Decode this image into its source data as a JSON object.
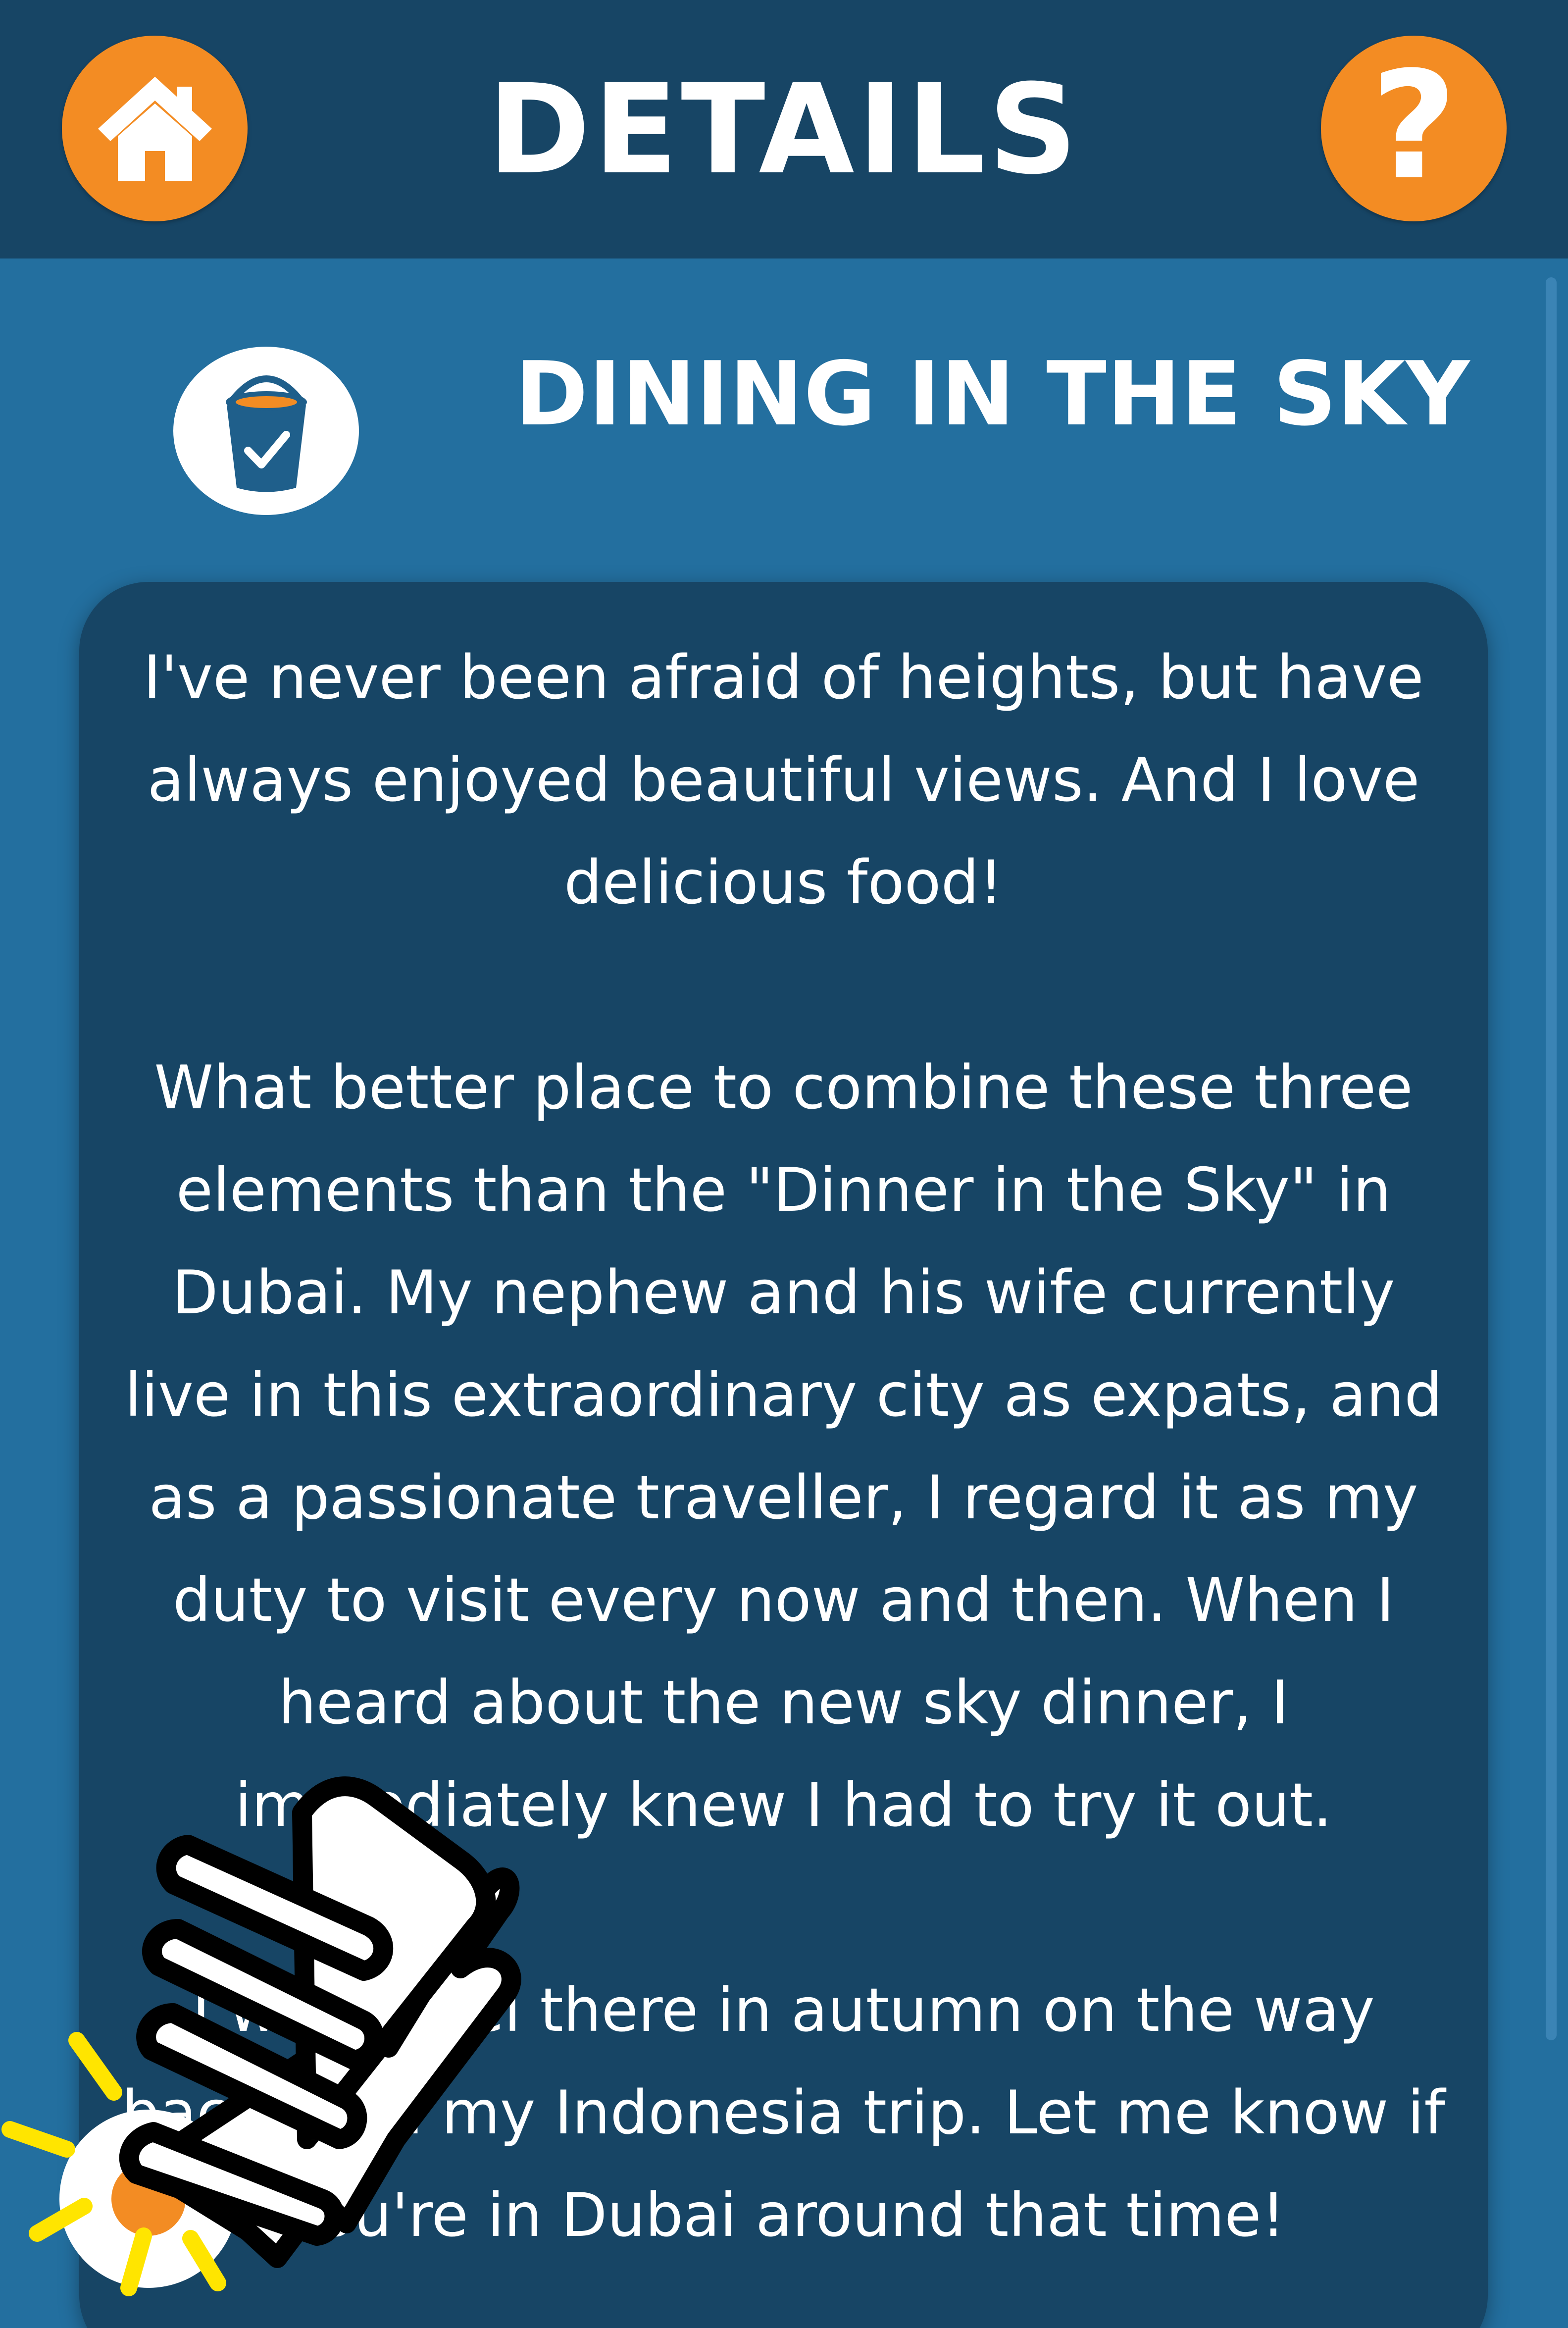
{
  "header": {
    "title": "DETAILS",
    "home_icon": "home-icon",
    "help_icon": "question-mark-icon",
    "help_glyph": "?"
  },
  "entry": {
    "icon": "bucket-checkmark-icon",
    "title": "DINING IN THE SKY",
    "paragraphs": [
      "I've never been afraid of heights, but have always enjoyed beautiful views. And I love delicious food!",
      "What better place to combine these three elements than the \"Dinner in the Sky\" in Dubai. My nephew and his wife currently live in this extraordinary city as expats, and as a passionate traveller, I regard it as my duty to visit every now and then. When I heard about the new sky dinner, I immediately knew I had to try it out.",
      "I will travel there in autumn on the way back from my Indonesia trip. Let me know if you're in Dubai around that time!"
    ]
  },
  "overlay": {
    "hint_icon": "tap-hand-icon"
  },
  "colors": {
    "header_bg": "#174565",
    "page_bg": "#236f9f",
    "card_bg": "#174565",
    "accent": "#f38c23",
    "text": "#ffffff",
    "tap_rays": "#ffe500"
  }
}
